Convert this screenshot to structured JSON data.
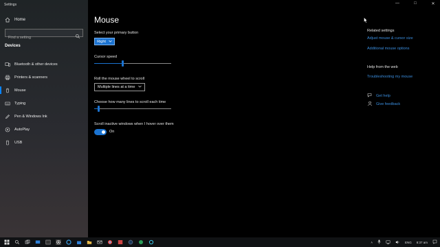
{
  "window": {
    "title": "Settings",
    "controls": [
      "minimize-icon",
      "maximize-icon",
      "close-icon"
    ]
  },
  "sidebar": {
    "home_label": "Home",
    "search_placeholder": "Find a setting",
    "section_title": "Devices",
    "items": [
      {
        "label": "Bluetooth & other devices",
        "icon": "bluetooth-devices-icon"
      },
      {
        "label": "Printers & scanners",
        "icon": "printer-icon"
      },
      {
        "label": "Mouse",
        "icon": "mouse-icon",
        "active": true
      },
      {
        "label": "Typing",
        "icon": "keyboard-icon"
      },
      {
        "label": "Pen & Windows Ink",
        "icon": "pen-icon"
      },
      {
        "label": "AutoPlay",
        "icon": "autoplay-icon"
      },
      {
        "label": "USB",
        "icon": "usb-icon"
      }
    ]
  },
  "main": {
    "title": "Mouse",
    "primary_button": {
      "label": "Select your primary button",
      "value": "Right"
    },
    "cursor_speed": {
      "label": "Cursor speed",
      "value": 0.37
    },
    "scroll_wheel": {
      "label": "Roll the mouse wheel to scroll",
      "value": "Multiple lines at a time"
    },
    "lines_to_scroll": {
      "label": "Choose how many lines to scroll each time",
      "value": 0.05
    },
    "inactive_scroll": {
      "label": "Scroll inactive windows when I hover over them",
      "state": "On"
    }
  },
  "related": {
    "title": "Related settings",
    "links": [
      "Adjust mouse & cursor size",
      "Additional mouse options"
    ]
  },
  "help": {
    "title": "Help from the web",
    "link": "Troubleshooting my mouse",
    "get_help": "Get help",
    "feedback": "Give feedback"
  },
  "taskbar": {
    "language": "ENG",
    "time": "8:37 am"
  },
  "colors": {
    "accent": "#1b73d1",
    "link": "#3b8fe0",
    "background": "#000000"
  }
}
